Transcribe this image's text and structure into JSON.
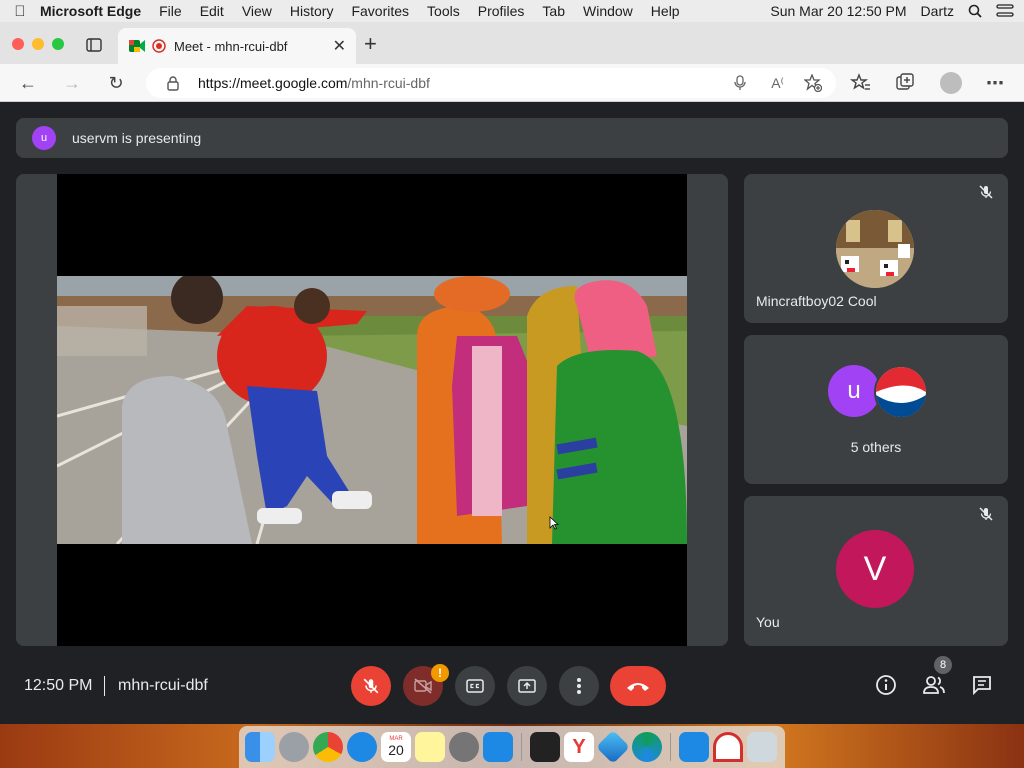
{
  "menubar": {
    "app_name": "Microsoft Edge",
    "items": [
      "File",
      "Edit",
      "View",
      "History",
      "Favorites",
      "Tools",
      "Profiles",
      "Tab",
      "Window",
      "Help"
    ],
    "clock": "Sun Mar 20  12:50 PM",
    "user": "Dartz"
  },
  "browser": {
    "tab_title": "Meet - mhn-rcui-dbf",
    "url_host": "https://meet.google.com",
    "url_path": "/mhn-rcui-dbf"
  },
  "meet": {
    "presenting_initial": "u",
    "presenting_text": "uservm is presenting",
    "tiles": [
      {
        "name": "Mincraftboy02 Cool"
      },
      {
        "name": "5 others",
        "avatar_initial": "u"
      },
      {
        "name": "You",
        "avatar_initial": "V"
      }
    ],
    "controls": {
      "time": "12:50 PM",
      "meeting_code": "mhn-rcui-dbf",
      "camera_warning": "!",
      "people_count": "8"
    }
  },
  "dock": {
    "calendar_month": "MAR",
    "calendar_day": "20"
  },
  "colors": {
    "meet_bg": "#202124",
    "tile_bg": "#3c4043",
    "danger": "#ea4335",
    "presenter_avatar": "#a142f4",
    "you_avatar": "#c2185b"
  }
}
